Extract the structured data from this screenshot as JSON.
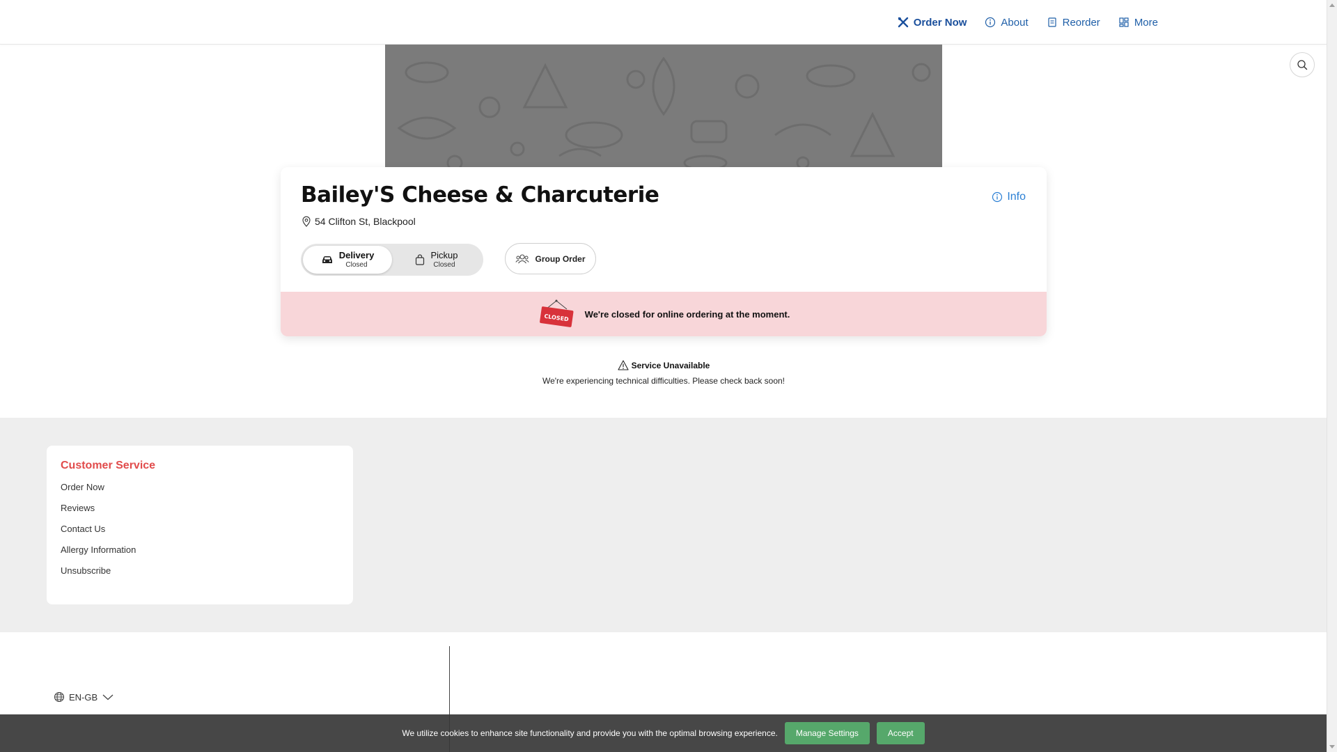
{
  "nav": {
    "items": [
      {
        "label": "Order Now",
        "icon": "utensils-icon"
      },
      {
        "label": "About",
        "icon": "info-circle-icon"
      },
      {
        "label": "Reorder",
        "icon": "receipt-icon"
      },
      {
        "label": "More",
        "icon": "grid-icon"
      }
    ]
  },
  "store": {
    "name": "Bailey'S Cheese & Charcuterie",
    "address": "54 Clifton St, Blackpool",
    "info_label": "Info",
    "modes": [
      {
        "name": "Delivery",
        "status": "Closed"
      },
      {
        "name": "Pickup",
        "status": "Closed"
      }
    ],
    "group_order_label": "Group Order",
    "closed_sign": "CLOSED",
    "closed_message": "We're closed for online ordering at the moment."
  },
  "service": {
    "title": "Service Unavailable",
    "message": "We're experiencing technical difficulties. Please check back soon!"
  },
  "footer": {
    "customer_service_title": "Customer Service",
    "links": [
      "Order Now",
      "Reviews",
      "Contact Us",
      "Allergy Information",
      "Unsubscribe"
    ],
    "language": "EN-GB"
  },
  "cookie": {
    "text": "We utilize cookies to enhance site functionality and provide you with the optimal browsing experience.",
    "manage_label": "Manage Settings",
    "accept_label": "Accept"
  },
  "colors": {
    "nav_link": "#1f5fa8",
    "accent_red": "#e14b4b",
    "closed_strip": "#f8d6d9",
    "cookie_button": "#56a86b",
    "info_blue": "#2a7fd4"
  }
}
